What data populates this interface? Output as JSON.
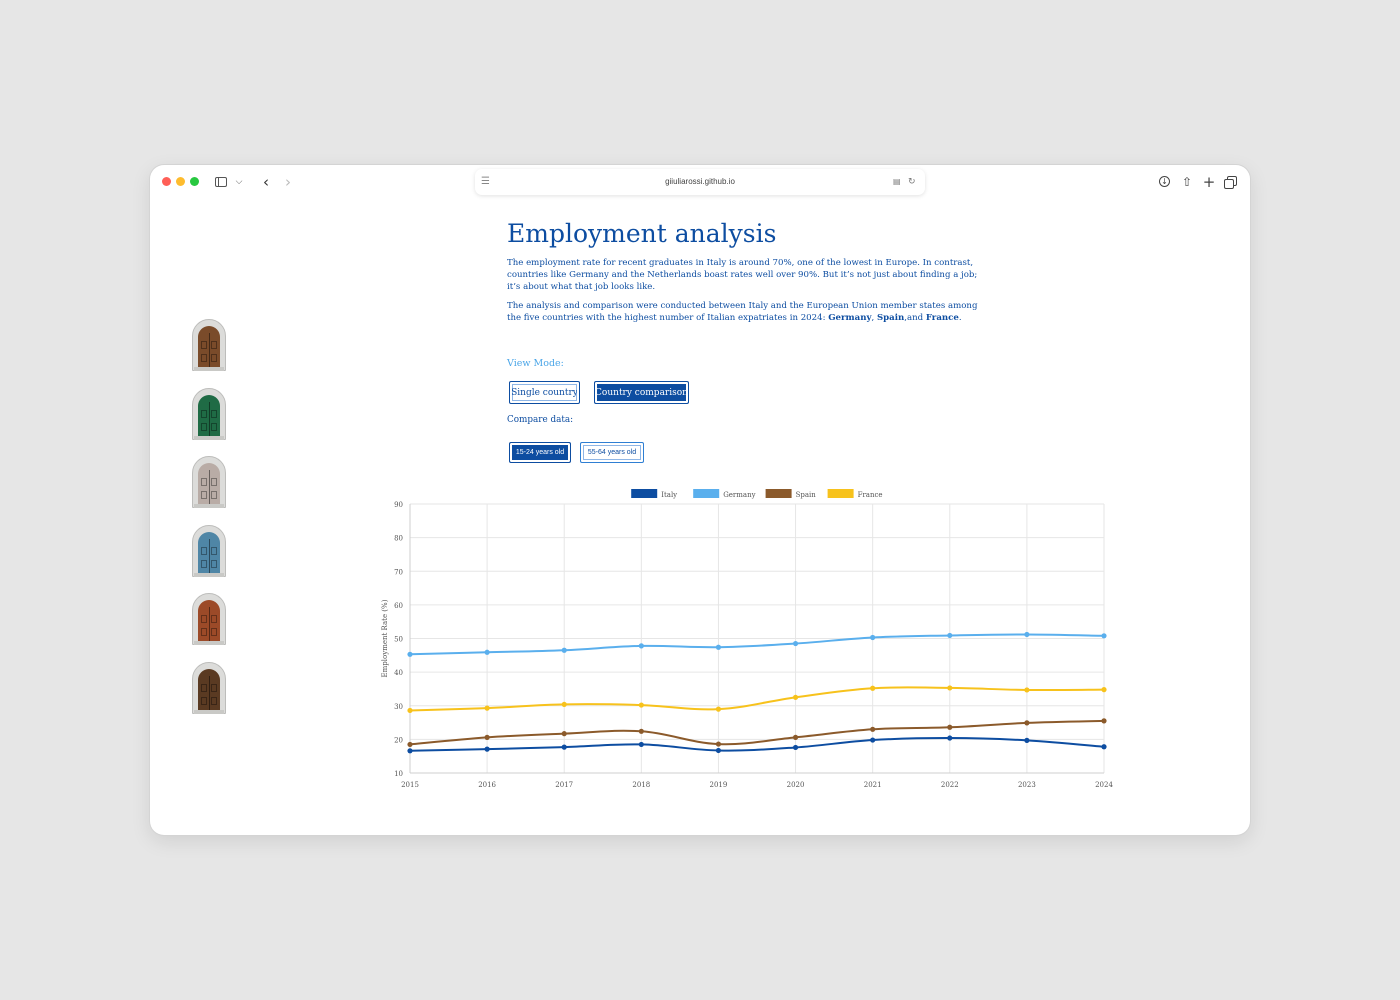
{
  "browser": {
    "url": "giiuliarossi.github.io"
  },
  "page": {
    "title": "Employment analysis",
    "intro": "The employment rate for recent graduates in Italy is around 70%, one of the lowest in Europe. In contrast, countries like Germany and the Netherlands boast rates well over 90%. But it’s not just about finding a job; it’s about what that job looks like.",
    "method_prefix": "The analysis and comparison were conducted between Italy and the European Union member states among the five countries with the highest number of Italian expatriates in 2024: ",
    "method_country_1": "Germany",
    "method_sep_1": ", ",
    "method_country_2": "Spain",
    "method_sep_2": ",and ",
    "method_country_3": "France",
    "method_suffix": ".",
    "view_mode_label": "View Mode:",
    "view_mode_buttons": [
      "Single country",
      "Country comparison"
    ],
    "view_mode_selected": "Country comparison",
    "compare_label": "Compare data:",
    "compare_buttons": [
      "15-24 years old",
      "55-64 years old"
    ],
    "compare_selected": "15-24 years old"
  },
  "sidebar": {
    "doors": [
      {
        "name": "door-brown-arched",
        "color": "#7a4b2a"
      },
      {
        "name": "door-green-arched",
        "color": "#1f6b45"
      },
      {
        "name": "door-grey-arched",
        "color": "#b9aca6"
      },
      {
        "name": "door-blue-arched",
        "color": "#4f86a6"
      },
      {
        "name": "door-red-arched",
        "color": "#9c4a28"
      },
      {
        "name": "door-dark-arched",
        "color": "#5a3a22"
      }
    ]
  },
  "chart_data": {
    "type": "line",
    "x": [
      "2015",
      "2016",
      "2017",
      "2018",
      "2019",
      "2020",
      "2021",
      "2022",
      "2023",
      "2024"
    ],
    "ylabel": "Employment Rate (%)",
    "ylim": [
      10,
      90
    ],
    "yticks": [
      10,
      20,
      30,
      40,
      50,
      60,
      70,
      80,
      90
    ],
    "grid": true,
    "legend_position": "top",
    "series": [
      {
        "name": "Italy",
        "color": "#0d4da1",
        "values": [
          16.6,
          17.1,
          17.7,
          18.5,
          16.7,
          17.6,
          19.8,
          20.4,
          19.7,
          17.8
        ]
      },
      {
        "name": "Germany",
        "color": "#5aafed",
        "values": [
          45.3,
          45.9,
          46.5,
          47.8,
          47.4,
          48.5,
          50.3,
          50.9,
          51.2,
          50.8
        ]
      },
      {
        "name": "Spain",
        "color": "#8b5a2b",
        "values": [
          18.5,
          20.6,
          21.7,
          22.4,
          18.6,
          20.6,
          23.0,
          23.6,
          24.9,
          25.5
        ]
      },
      {
        "name": "France",
        "color": "#f7c21c",
        "values": [
          28.6,
          29.3,
          30.4,
          30.2,
          29.0,
          32.5,
          35.2,
          35.3,
          34.7,
          34.8
        ]
      }
    ]
  }
}
